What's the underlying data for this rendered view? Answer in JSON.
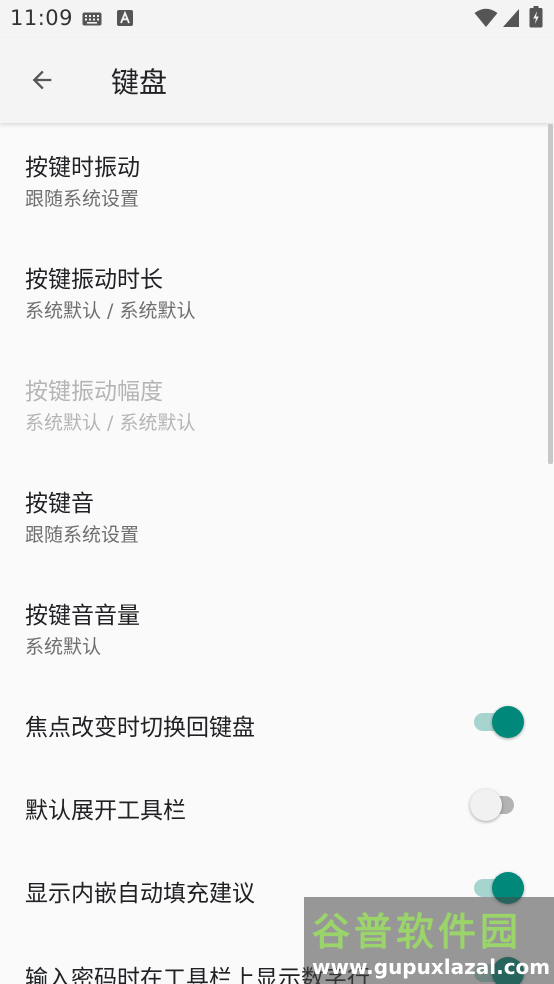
{
  "status_bar": {
    "time": "11:09",
    "icons": [
      "keyboard-icon",
      "a-letter-icon",
      "wifi-icon",
      "signal-icon",
      "battery-icon"
    ]
  },
  "app_bar": {
    "title": "键盘",
    "back_icon": "arrow-left-icon"
  },
  "preferences": [
    {
      "title": "按键时振动",
      "summary": "跟随系统设置",
      "enabled": true
    },
    {
      "title": "按键振动时长",
      "summary": "系统默认 / 系统默认",
      "enabled": true
    },
    {
      "title": "按键振动幅度",
      "summary": "系统默认 / 系统默认",
      "enabled": false
    },
    {
      "title": "按键音",
      "summary": "跟随系统设置",
      "enabled": true
    },
    {
      "title": "按键音音量",
      "summary": "系统默认",
      "enabled": true
    }
  ],
  "switches": [
    {
      "title": "焦点改变时切换回键盘",
      "checked": true
    },
    {
      "title": "默认展开工具栏",
      "checked": false
    },
    {
      "title": "显示内嵌自动填充建议",
      "checked": true
    },
    {
      "title": "输入密码时在工具栏上显示数字行",
      "checked": true
    }
  ],
  "watermark": {
    "title": "谷普软件园",
    "url": "www.gupuxlazal.com"
  },
  "colors": {
    "accent": "#00897b",
    "accent_track": "#a7d4cf",
    "background": "#fafafa",
    "app_bar": "#f4f4f4",
    "disabled_text": "#b5b5b5"
  }
}
